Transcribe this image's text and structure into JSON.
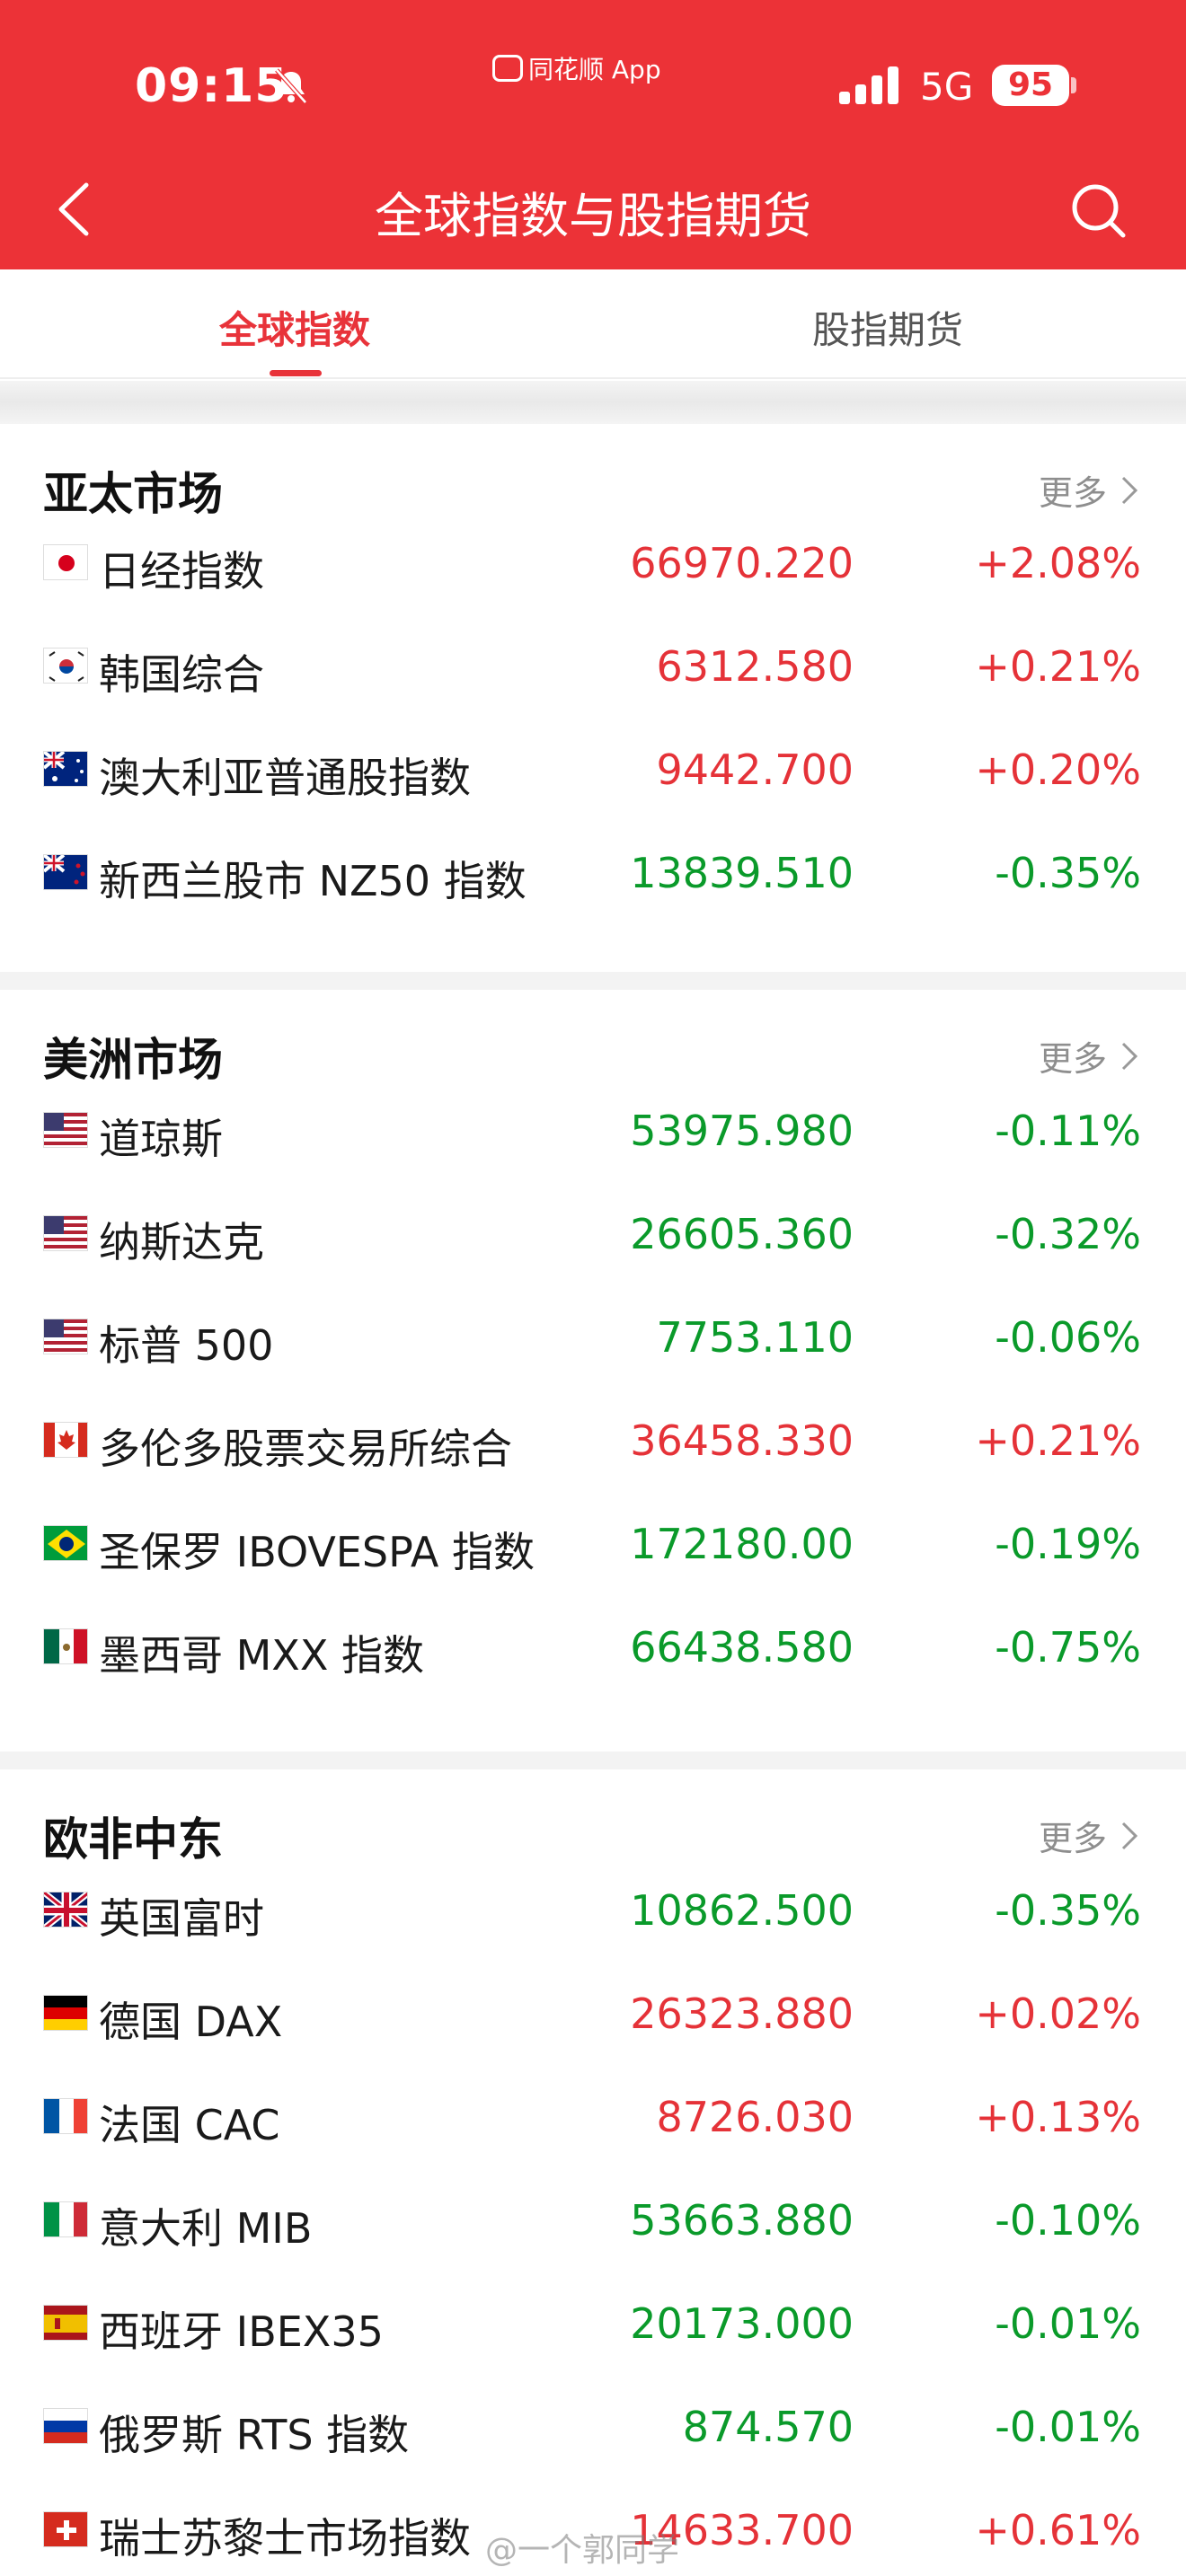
{
  "status": {
    "time": "09:15",
    "app_badge": "同花顺 App",
    "network": "5G",
    "battery": "95"
  },
  "header": {
    "title": "全球指数与股指期货"
  },
  "tabs": [
    {
      "label": "全球指数",
      "active": true
    },
    {
      "label": "股指期货",
      "active": false
    }
  ],
  "more_label": "更多",
  "sections": [
    {
      "title": "亚太市场",
      "rows": [
        {
          "flag": "jp",
          "name": "日经指数",
          "value": "66970.220",
          "change": "+2.08%",
          "dir": "up"
        },
        {
          "flag": "kr",
          "name": "韩国综合",
          "value": "6312.580",
          "change": "+0.21%",
          "dir": "up"
        },
        {
          "flag": "au",
          "name": "澳大利亚普通股指数",
          "value": "9442.700",
          "change": "+0.20%",
          "dir": "up"
        },
        {
          "flag": "nz",
          "name": "新西兰股市 NZ50 指数",
          "value": "13839.510",
          "change": "-0.35%",
          "dir": "down"
        }
      ]
    },
    {
      "title": "美洲市场",
      "rows": [
        {
          "flag": "us",
          "name": "道琼斯",
          "value": "53975.980",
          "change": "-0.11%",
          "dir": "down"
        },
        {
          "flag": "us",
          "name": "纳斯达克",
          "value": "26605.360",
          "change": "-0.32%",
          "dir": "down"
        },
        {
          "flag": "us",
          "name": "标普 500",
          "value": "7753.110",
          "change": "-0.06%",
          "dir": "down"
        },
        {
          "flag": "ca",
          "name": "多伦多股票交易所综合",
          "value": "36458.330",
          "change": "+0.21%",
          "dir": "up"
        },
        {
          "flag": "br",
          "name": "圣保罗 IBOVESPA 指数",
          "value": "172180.00",
          "change": "-0.19%",
          "dir": "down"
        },
        {
          "flag": "mx",
          "name": "墨西哥 MXX 指数",
          "value": "66438.580",
          "change": "-0.75%",
          "dir": "down"
        }
      ]
    },
    {
      "title": "欧非中东",
      "rows": [
        {
          "flag": "gb",
          "name": "英国富时",
          "value": "10862.500",
          "change": "-0.35%",
          "dir": "down"
        },
        {
          "flag": "de",
          "name": "德国 DAX",
          "value": "26323.880",
          "change": "+0.02%",
          "dir": "up"
        },
        {
          "flag": "fr",
          "name": "法国 CAC",
          "value": "8726.030",
          "change": "+0.13%",
          "dir": "up"
        },
        {
          "flag": "it",
          "name": "意大利 MIB",
          "value": "53663.880",
          "change": "-0.10%",
          "dir": "down"
        },
        {
          "flag": "es",
          "name": "西班牙 IBEX35",
          "value": "20173.000",
          "change": "-0.01%",
          "dir": "down"
        },
        {
          "flag": "ru",
          "name": "俄罗斯 RTS 指数",
          "value": "874.570",
          "change": "-0.01%",
          "dir": "down"
        },
        {
          "flag": "ch",
          "name": "瑞士苏黎士市场指数",
          "value": "14633.700",
          "change": "+0.61%",
          "dir": "up"
        }
      ]
    }
  ],
  "colors": {
    "brand": "#ec3237",
    "up": "#e53238",
    "down": "#0a9a2a"
  },
  "watermark": "@一个郭同学"
}
